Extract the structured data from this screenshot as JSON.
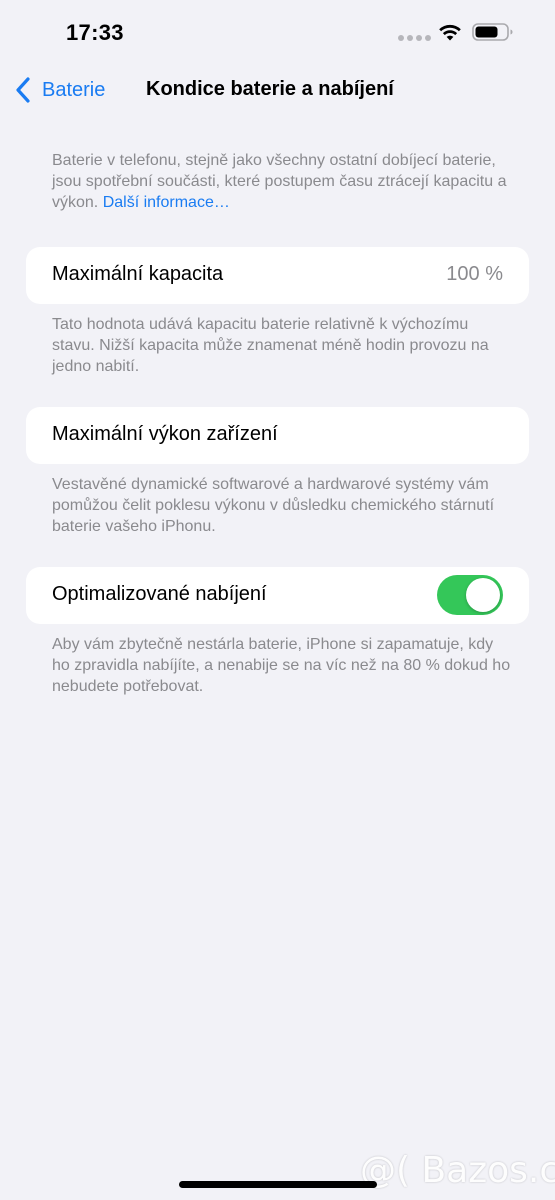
{
  "status_bar": {
    "time": "17:33",
    "icons": [
      "signal-dots-icon",
      "wifi-icon",
      "battery-icon"
    ]
  },
  "nav": {
    "back_label": "Baterie",
    "title": "Kondice baterie a nabíjení"
  },
  "intro": {
    "text": "Baterie v telefonu, stejně jako všechny ostatní dobíjecí baterie, jsou spotřební součásti, které postupem času ztrácejí kapacitu a výkon. ",
    "link_text": "Další informace…"
  },
  "max_capacity": {
    "label": "Maximální kapacita",
    "value": "100 %",
    "footnote": "Tato hodnota udává kapacitu baterie relativně k výchozímu stavu. Nižší kapacita může znamenat méně hodin provozu na jedno nabití."
  },
  "peak_performance": {
    "label": "Maximální výkon zařízení",
    "footnote": "Vestavěné dynamické softwarové a hardwarové systémy vám pomůžou čelit poklesu výkonu v důsledku chemického stárnutí baterie vašeho iPhonu."
  },
  "optimized_charging": {
    "label": "Optimalizované nabíjení",
    "enabled": true,
    "footnote": "Aby vám zbytečně nestárla baterie, iPhone si zapamatuje, kdy ho zpravidla nabíjíte, a nenabije se na víc než na 80 % dokud ho nebudete potřebovat."
  },
  "watermark": "@( Bazos.cz",
  "colors": {
    "accent": "#1a7cf2",
    "toggle_on": "#34c759",
    "background": "#f2f2f7",
    "secondary_text": "#8a8a8e"
  }
}
